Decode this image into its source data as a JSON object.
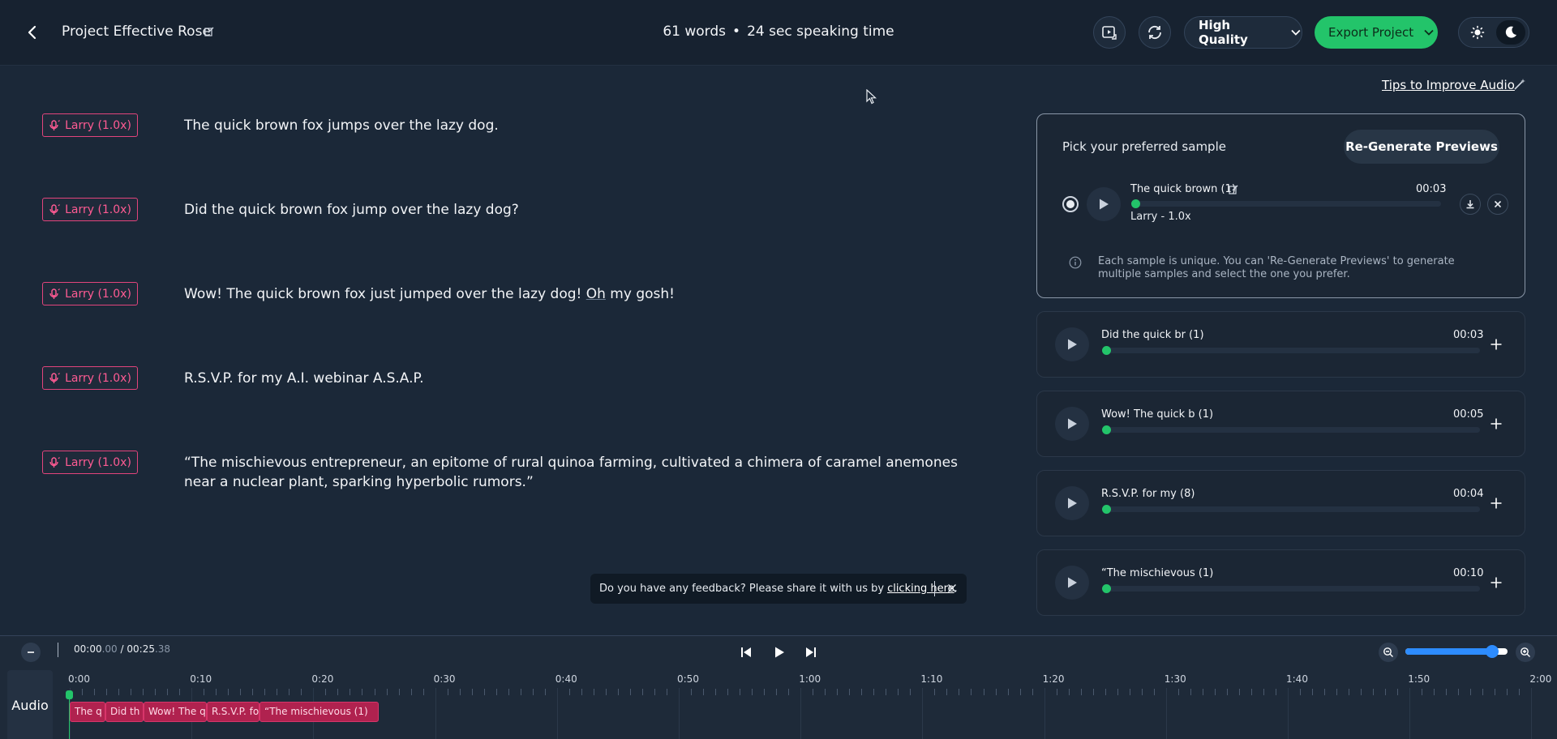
{
  "header": {
    "back_icon": "chevron-left-icon",
    "project_title": "Project Effective Rose",
    "word_count": "61 words",
    "speaking_time": "24 sec speaking time",
    "separator": "•",
    "quality_label": "High Quality",
    "export_label": "Export Project"
  },
  "tips_label": "Tips to Improve Audio",
  "lines": [
    {
      "voice": "Larry (1.0x)",
      "text": "The quick brown fox jumps over the lazy dog."
    },
    {
      "voice": "Larry (1.0x)",
      "text": "Did the quick brown fox jump over the lazy dog?"
    },
    {
      "voice": "Larry (1.0x)",
      "text_before": "Wow! The quick brown fox just jumped over the lazy dog! ",
      "text_underlined": "Oh",
      "text_after": " my gosh!"
    },
    {
      "voice": "Larry (1.0x)",
      "text": "R.S.V.P. for my A.I. webinar A.S.A.P."
    },
    {
      "voice": "Larry (1.0x)",
      "text": "“The mischievous entrepreneur, an epitome of rural quinoa farming, cultivated a chimera of caramel anemones near a nuclear plant, sparking hyperbolic rumors.”"
    }
  ],
  "preview_panel": {
    "title": "Pick your preferred sample",
    "regenerate_label": "Re-Generate Previews",
    "sample": {
      "name": "The quick brown (1)",
      "time": "00:03",
      "voice": "Larry - 1.0x",
      "progress": 0
    },
    "info_text": "Each sample is unique. You can 'Re-Generate Previews' to generate multiple samples and select the one you prefer."
  },
  "cards": [
    {
      "name": "Did the quick br (1)",
      "time": "00:03",
      "progress": 0
    },
    {
      "name": "Wow! The quick b (1)",
      "time": "00:05",
      "progress": 0
    },
    {
      "name": "R.S.V.P. for my (8)",
      "time": "00:04",
      "progress": 0
    },
    {
      "name": "“The mischievous (1)",
      "time": "00:10",
      "progress": 0
    }
  ],
  "feedback": {
    "text": "Do you have any feedback? Please share it with us by",
    "link": "clicking here",
    "period": "."
  },
  "timeline": {
    "current": "00:00",
    "current_frac": ".00",
    "divider": "/",
    "total": "00:25",
    "total_frac": ".38",
    "zoom_level": 0.85,
    "track_label": "Audio",
    "ticks": [
      "0:00",
      "0:10",
      "0:20",
      "0:30",
      "0:40",
      "0:50",
      "1:00",
      "1:10",
      "1:20",
      "1:30",
      "1:40",
      "1:50",
      "2:00"
    ],
    "clips": [
      "The q",
      "Did th",
      "Wow! The q",
      "R.S.V.P. fo",
      "“The mischievous (1)"
    ]
  },
  "colors": {
    "accent_green": "#23c46a",
    "voice_pink": "#ff5b93",
    "clip_red": "#b0224f",
    "slider_blue": "#2d8cff"
  }
}
